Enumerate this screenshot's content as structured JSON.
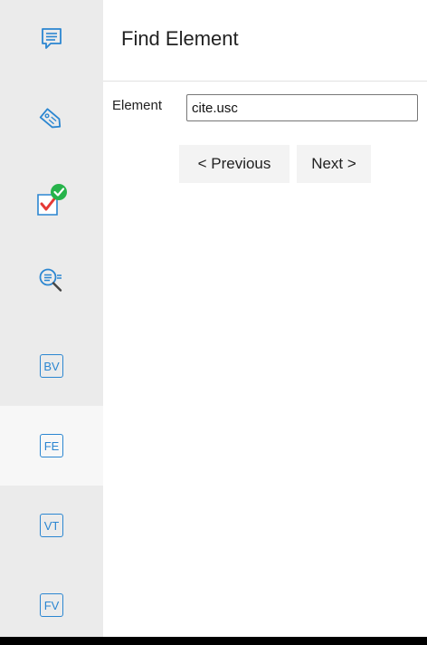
{
  "sidebar": {
    "items": [
      {
        "name": "comment-icon",
        "label": ""
      },
      {
        "name": "tag-icon",
        "label": ""
      },
      {
        "name": "checklist-success-icon",
        "label": ""
      },
      {
        "name": "search-list-icon",
        "label": ""
      },
      {
        "name": "bv",
        "label": "BV"
      },
      {
        "name": "fe",
        "label": "FE",
        "active": true
      },
      {
        "name": "vt",
        "label": "VT"
      },
      {
        "name": "fv",
        "label": "FV"
      }
    ]
  },
  "main": {
    "title": "Find Element",
    "element_label": "Element",
    "element_value": "cite.usc",
    "previous_label": "< Previous",
    "next_label": "Next >"
  },
  "colors": {
    "accent": "#2b86d1",
    "success": "#27b34b",
    "error_red": "#e53935",
    "sidebar_bg": "#ebebeb",
    "active_bg": "#f7f7f7"
  }
}
